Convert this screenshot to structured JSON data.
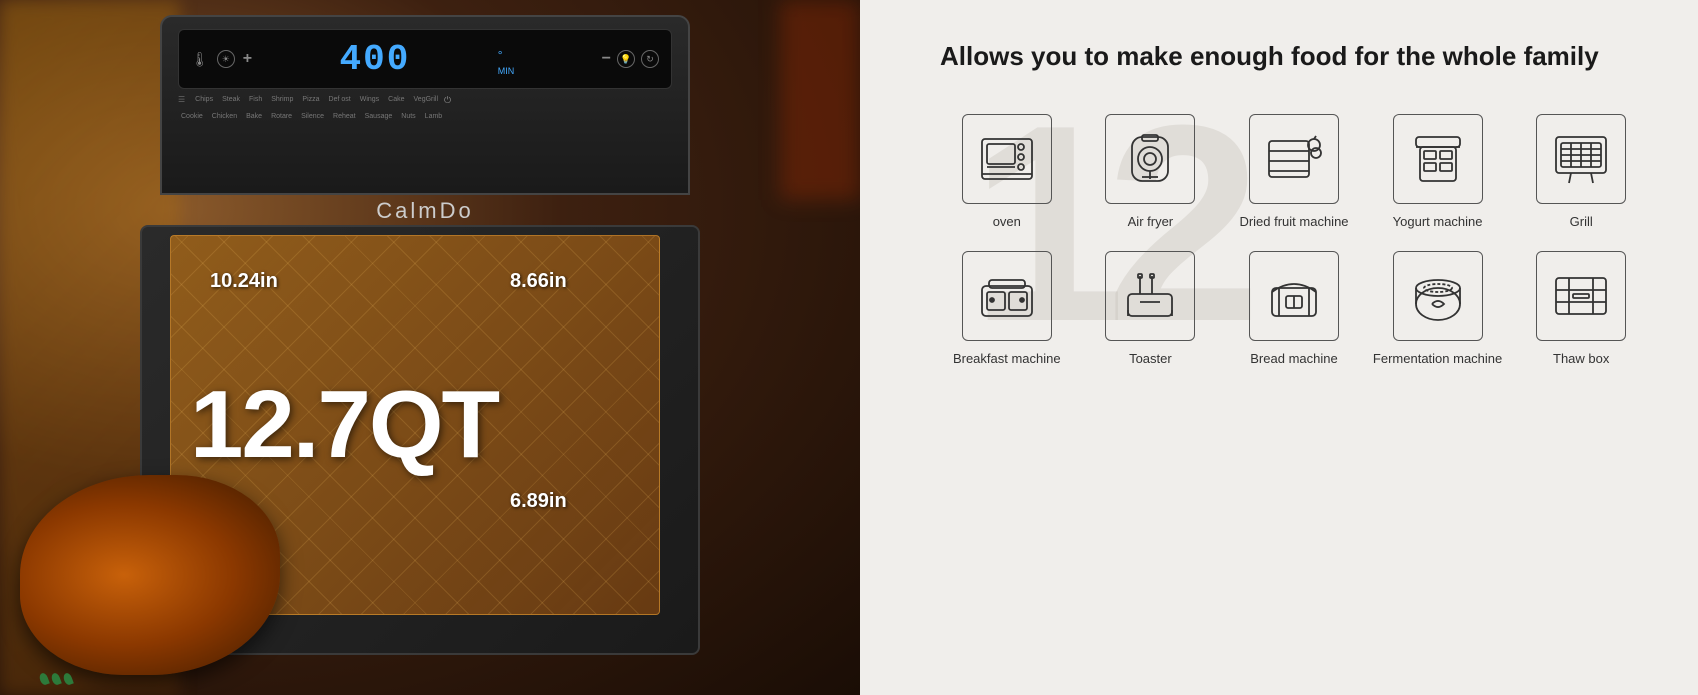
{
  "left": {
    "brand": "CalmDo",
    "temp": "400",
    "capacity": "12.7QT",
    "dimensions": {
      "width": "10.24in",
      "depth": "8.66in",
      "height": "6.89in"
    },
    "presets": [
      "Chips",
      "Steak",
      "Fish",
      "Shrimp",
      "Pizza",
      "Defrost",
      "Wings",
      "Cake",
      "VegGrill",
      "Cookie",
      "Chicken",
      "Bake",
      "Rotare",
      "Silence",
      "Reheat",
      "Sausage",
      "Nuts",
      "Lamb"
    ]
  },
  "right": {
    "headline": "Allows you to make enough food for the whole family",
    "watermark": "12",
    "icons": [
      {
        "id": "oven",
        "label": "oven"
      },
      {
        "id": "air-fryer",
        "label": "Air fryer"
      },
      {
        "id": "dried-fruit",
        "label": "Dried fruit machine"
      },
      {
        "id": "yogurt",
        "label": "Yogurt machine"
      },
      {
        "id": "grill",
        "label": "Grill"
      },
      {
        "id": "breakfast",
        "label": "Breakfast machine"
      },
      {
        "id": "toaster",
        "label": "Toaster"
      },
      {
        "id": "bread",
        "label": "Bread machine"
      },
      {
        "id": "fermentation",
        "label": "Fermentation machine"
      },
      {
        "id": "thaw",
        "label": "Thaw box"
      }
    ]
  }
}
